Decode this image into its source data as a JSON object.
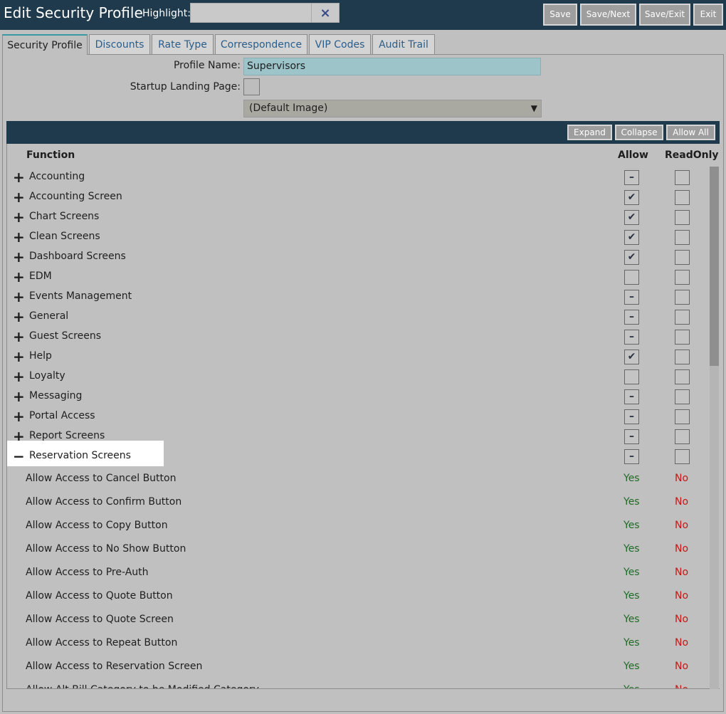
{
  "header": {
    "title": "Edit Security Profile",
    "highlight_label": "Highlight:",
    "highlight_value": "",
    "clear_icon": "×",
    "buttons": {
      "save": "Save",
      "save_next": "Save/Next",
      "save_exit": "Save/Exit",
      "exit": "Exit"
    }
  },
  "tabs": [
    "Security Profile",
    "Discounts",
    "Rate Type",
    "Correspondence",
    "VIP Codes",
    "Audit Trail"
  ],
  "form": {
    "profile_name_label": "Profile Name:",
    "profile_name_value": "Supervisors",
    "landing_label": "Startup Landing Page:",
    "image_select": "(Default Image)"
  },
  "grid": {
    "buttons": {
      "expand": "Expand",
      "collapse": "Collapse",
      "allow_all": "Allow All"
    },
    "headers": {
      "function": "Function",
      "allow": "Allow",
      "readonly": "ReadOnly"
    },
    "rows": [
      {
        "name": "Accounting",
        "allow": "partial"
      },
      {
        "name": "Accounting Screen",
        "allow": "checked"
      },
      {
        "name": "Chart Screens",
        "allow": "checked"
      },
      {
        "name": "Clean Screens",
        "allow": "checked"
      },
      {
        "name": "Dashboard Screens",
        "allow": "checked"
      },
      {
        "name": "EDM",
        "allow": "empty"
      },
      {
        "name": "Events Management",
        "allow": "partial"
      },
      {
        "name": "General",
        "allow": "partial"
      },
      {
        "name": "Guest Screens",
        "allow": "partial"
      },
      {
        "name": "Help",
        "allow": "checked"
      },
      {
        "name": "Loyalty",
        "allow": "empty"
      },
      {
        "name": "Messaging",
        "allow": "partial"
      },
      {
        "name": "Portal Access",
        "allow": "partial"
      },
      {
        "name": "Report Screens",
        "allow": "partial"
      },
      {
        "name": "Reservation Screens",
        "allow": "partial",
        "expanded": true
      }
    ],
    "sub_rows": [
      {
        "name": "Allow Access to Cancel Button",
        "allow": "Yes",
        "readonly": "No"
      },
      {
        "name": "Allow Access to Confirm Button",
        "allow": "Yes",
        "readonly": "No"
      },
      {
        "name": "Allow Access to Copy Button",
        "allow": "Yes",
        "readonly": "No"
      },
      {
        "name": "Allow Access to No Show Button",
        "allow": "Yes",
        "readonly": "No"
      },
      {
        "name": "Allow Access to Pre-Auth",
        "allow": "Yes",
        "readonly": "No"
      },
      {
        "name": "Allow Access to Quote Button",
        "allow": "Yes",
        "readonly": "No"
      },
      {
        "name": "Allow Access to Quote Screen",
        "allow": "Yes",
        "readonly": "No"
      },
      {
        "name": "Allow Access to Repeat Button",
        "allow": "Yes",
        "readonly": "No"
      },
      {
        "name": "Allow Access to Reservation Screen",
        "allow": "Yes",
        "readonly": "No"
      },
      {
        "name": "Allow Alt Bill Category to be Modified Category",
        "allow": "Yes",
        "readonly": "No"
      }
    ],
    "glyphs": {
      "plus": "+",
      "minus": "−",
      "check": "✔",
      "dash": "–"
    }
  }
}
